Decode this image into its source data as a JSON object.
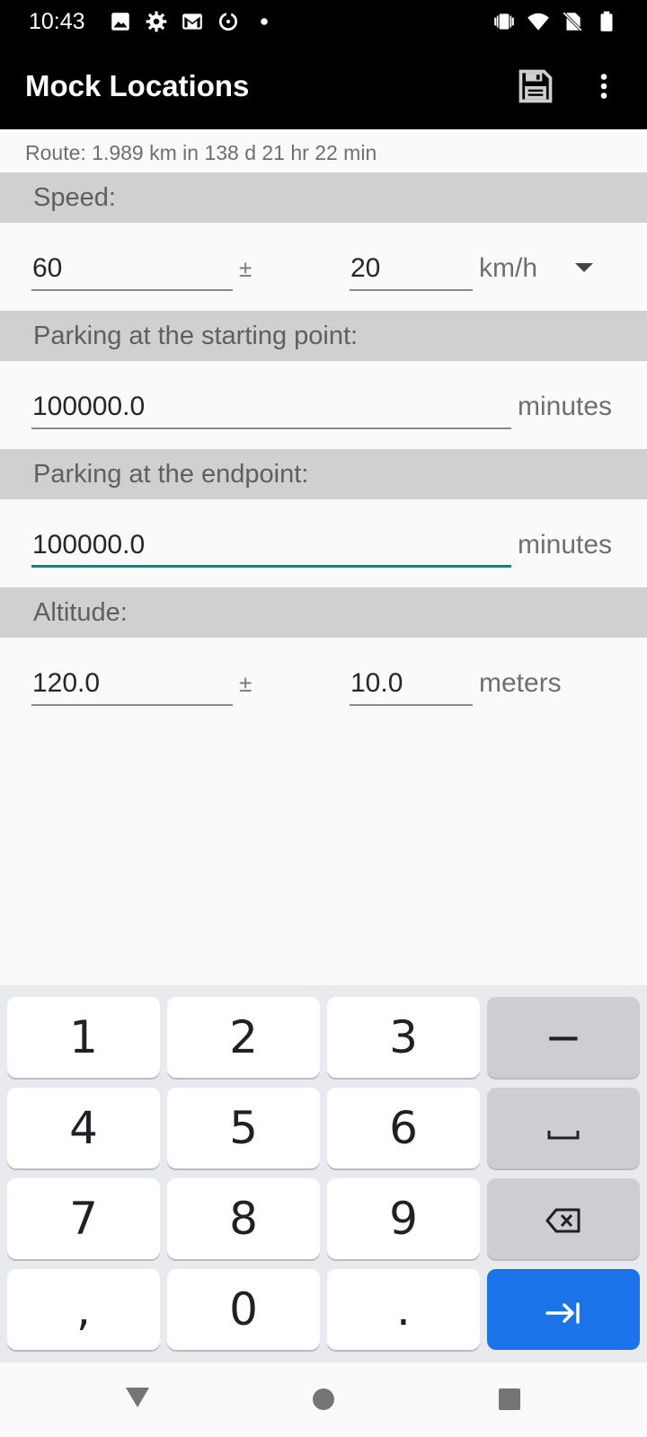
{
  "status_bar": {
    "time": "10:43",
    "left_icons": [
      "image-icon",
      "settings-icon",
      "gmail-icon",
      "sync-icon",
      "dot-icon"
    ],
    "right_icons": [
      "vibrate-icon",
      "wifi-icon",
      "no-sim-icon",
      "battery-icon"
    ]
  },
  "app_bar": {
    "title": "Mock Locations",
    "actions": [
      "save-icon",
      "more-vert-icon"
    ]
  },
  "route": {
    "summary": "Route: 1.989 km in 138 d 21 hr 22 min"
  },
  "speed": {
    "header": "Speed:",
    "value": "60",
    "plusminus": "±",
    "deviation": "20",
    "unit": "km/h"
  },
  "parking_start": {
    "header": "Parking at the starting point:",
    "value": "100000.0",
    "unit": "minutes"
  },
  "parking_end": {
    "header": "Parking at the endpoint:",
    "value": "100000.0",
    "unit": "minutes"
  },
  "altitude": {
    "header": "Altitude:",
    "value": "120.0",
    "plusminus": "±",
    "deviation": "10.0",
    "unit": "meters"
  },
  "keyboard": {
    "rows": [
      [
        "1",
        "2",
        "3",
        "−"
      ],
      [
        "4",
        "5",
        "6",
        "␣"
      ],
      [
        "7",
        "8",
        "9",
        "⌫"
      ],
      [
        ",",
        "0",
        ".",
        "⇥"
      ]
    ],
    "colors": {
      "key": "#ffffff",
      "func_key": "#ccced3",
      "enter_key": "#1a73e8",
      "background": "#e8eaed"
    }
  },
  "nav_bar": {
    "buttons": [
      "back-icon",
      "home-icon",
      "recents-icon"
    ]
  },
  "colors": {
    "app_bar": "#000000",
    "section_header": "#d0d0d0",
    "focus_underline": "#00897b"
  }
}
